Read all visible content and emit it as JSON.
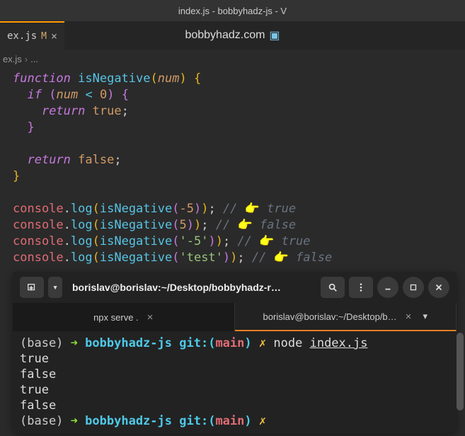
{
  "window_title": "index.js - bobbyhadz-js - V",
  "tab": {
    "name": "ex.js",
    "status": "M"
  },
  "watermark": "bobbyhadz.com",
  "breadcrumb": {
    "file": "ex.js",
    "more": "..."
  },
  "code": {
    "fn_keyword": "function",
    "fn_name": "isNegative",
    "param": "num",
    "if_kw": "if",
    "cond_op": "<",
    "cond_val": "0",
    "return_kw": "return",
    "true_val": "true",
    "false_val": "false",
    "console": "console",
    "log": "log",
    "calls": [
      {
        "arg": "-5",
        "is_str": false,
        "comment": "true"
      },
      {
        "arg": "5",
        "is_str": false,
        "comment": "false"
      },
      {
        "arg": "'-5'",
        "is_str": true,
        "comment": "true"
      },
      {
        "arg": "'test'",
        "is_str": true,
        "comment": "false"
      }
    ]
  },
  "terminal": {
    "title": "borislav@borislav:~/Desktop/bobbyhadz-r…",
    "tabs": [
      {
        "label": "npx serve .",
        "active": false
      },
      {
        "label": "borislav@borislav:~/Desktop/b…",
        "active": true
      }
    ],
    "prompt": {
      "base": "(base)",
      "arrow": "➜",
      "dir": "bobbyhadz-js",
      "git": "git:(",
      "branch": "main",
      "git_close": ")",
      "dirty": "✗"
    },
    "cmd": {
      "bin": "node",
      "arg": "index.js"
    },
    "output": [
      "true",
      "false",
      "true",
      "false"
    ]
  }
}
